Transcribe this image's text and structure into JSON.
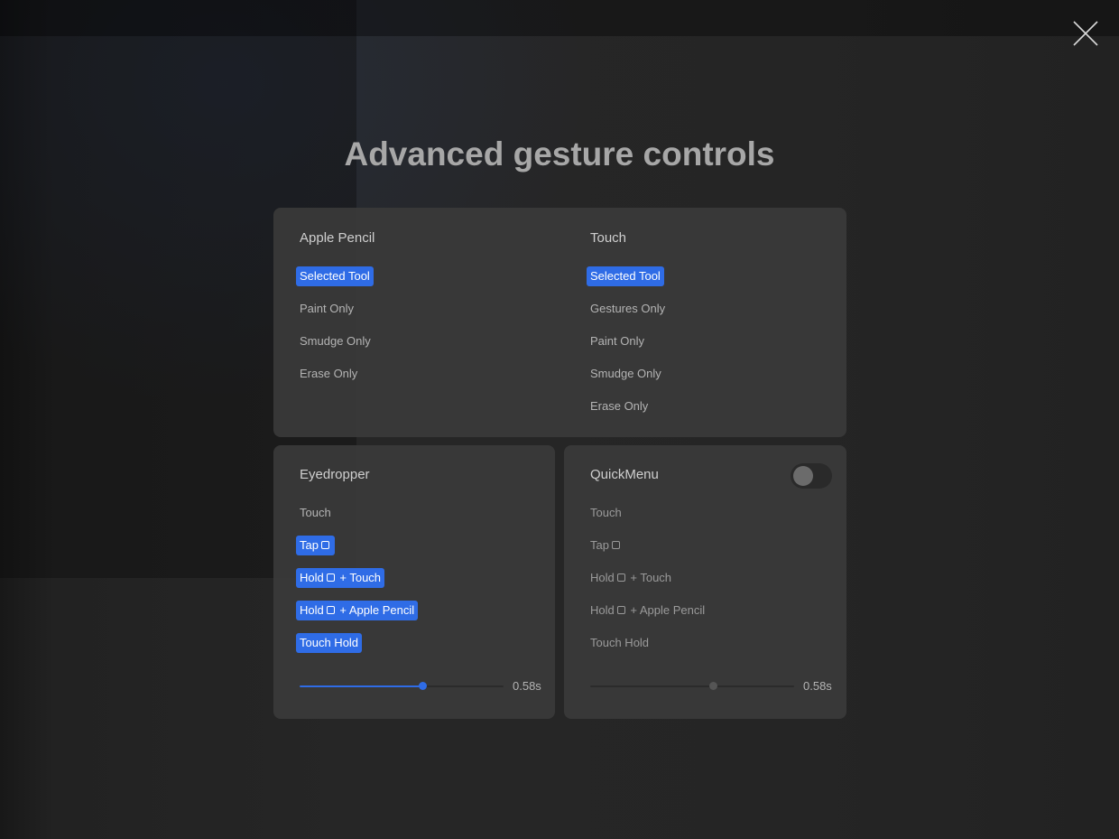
{
  "title": "Advanced gesture controls",
  "close_icon": "close-icon",
  "apple_pencil": {
    "heading": "Apple Pencil",
    "options": [
      {
        "label": "Selected Tool",
        "selected": true
      },
      {
        "label": "Paint Only",
        "selected": false
      },
      {
        "label": "Smudge Only",
        "selected": false
      },
      {
        "label": "Erase Only",
        "selected": false
      }
    ]
  },
  "touch": {
    "heading": "Touch",
    "options": [
      {
        "label": "Selected Tool",
        "selected": true
      },
      {
        "label": "Gestures Only",
        "selected": false
      },
      {
        "label": "Paint Only",
        "selected": false
      },
      {
        "label": "Smudge Only",
        "selected": false
      },
      {
        "label": "Erase Only",
        "selected": false
      }
    ]
  },
  "eyedropper": {
    "heading": "Eyedropper",
    "options": {
      "touch": "Touch",
      "tap": "Tap",
      "hold_touch_prefix": "Hold",
      "hold_touch_suffix": "+ Touch",
      "hold_pencil_prefix": "Hold",
      "hold_pencil_suffix": "+ Apple Pencil",
      "touch_hold": "Touch Hold"
    },
    "selected": [
      "tap",
      "hold_touch",
      "hold_pencil",
      "touch_hold"
    ],
    "delay_value": "0.58s",
    "delay_fraction": 0.6
  },
  "quickmenu": {
    "heading": "QuickMenu",
    "enabled": false,
    "options": {
      "touch": "Touch",
      "tap": "Tap",
      "hold_touch_prefix": "Hold",
      "hold_touch_suffix": "+ Touch",
      "hold_pencil_prefix": "Hold",
      "hold_pencil_suffix": "+ Apple Pencil",
      "touch_hold": "Touch Hold"
    },
    "delay_value": "0.58s",
    "delay_fraction": 0.6
  },
  "colors": {
    "accent": "#2f6ce6",
    "panel": "#3a3a3a",
    "background": "#1f1f1f"
  }
}
